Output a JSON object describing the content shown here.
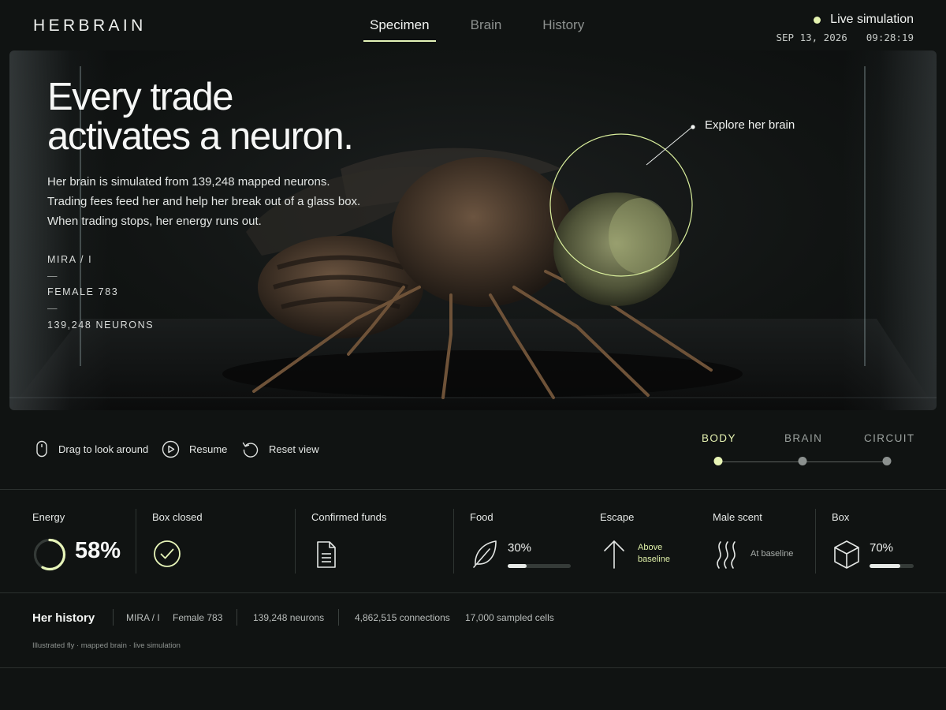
{
  "header": {
    "logo": "HERBRAIN",
    "tabs": [
      {
        "label": "Specimen",
        "active": true
      },
      {
        "label": "Brain",
        "active": false
      },
      {
        "label": "History",
        "active": false
      }
    ],
    "status": "Live simulation",
    "date": "SEP 13, 2026",
    "time": "09:28:19"
  },
  "hero": {
    "title_line1": "Every trade",
    "title_line2": "activates a neuron.",
    "desc_line1": "Her brain is simulated from 139,248 mapped neurons.",
    "desc_line2": "Trading fees feed her and help her break out of a glass box.",
    "desc_line3": "When trading stops, her energy runs out.",
    "meta_name": "MIRA / I",
    "meta_sex": "FEMALE 783",
    "meta_neurons": "139,248 NEURONS",
    "meta_dash": "—",
    "explore": "Explore her brain"
  },
  "controls": {
    "drag": "Drag to look around",
    "resume": "Resume",
    "reset": "Reset view",
    "views": [
      "BODY",
      "BRAIN",
      "CIRCUIT"
    ],
    "active_view": "BODY"
  },
  "stats": {
    "energy": {
      "label": "Energy",
      "value": "58%",
      "fraction": 0.58
    },
    "box_closed": {
      "label": "Box closed"
    },
    "funds": {
      "label": "Confirmed funds"
    },
    "food": {
      "label": "Food",
      "value": "30%",
      "fraction": 0.3
    },
    "escape": {
      "label": "Escape",
      "note_line1": "Above",
      "note_line2": "baseline"
    },
    "scent": {
      "label": "Male scent",
      "note": "At baseline"
    },
    "box": {
      "label": "Box",
      "value": "70%",
      "fraction": 0.7
    }
  },
  "history": {
    "title": "Her history",
    "name": "MIRA / I",
    "sex": "Female 783",
    "neurons": "139,248 neurons",
    "connections": "4,862,515 connections",
    "cells": "17,000 sampled cells",
    "caption": "Illustrated fly · mapped brain · live simulation"
  },
  "colors": {
    "accent": "#e4f3b0",
    "background": "#101312",
    "text": "#e9ecea"
  }
}
